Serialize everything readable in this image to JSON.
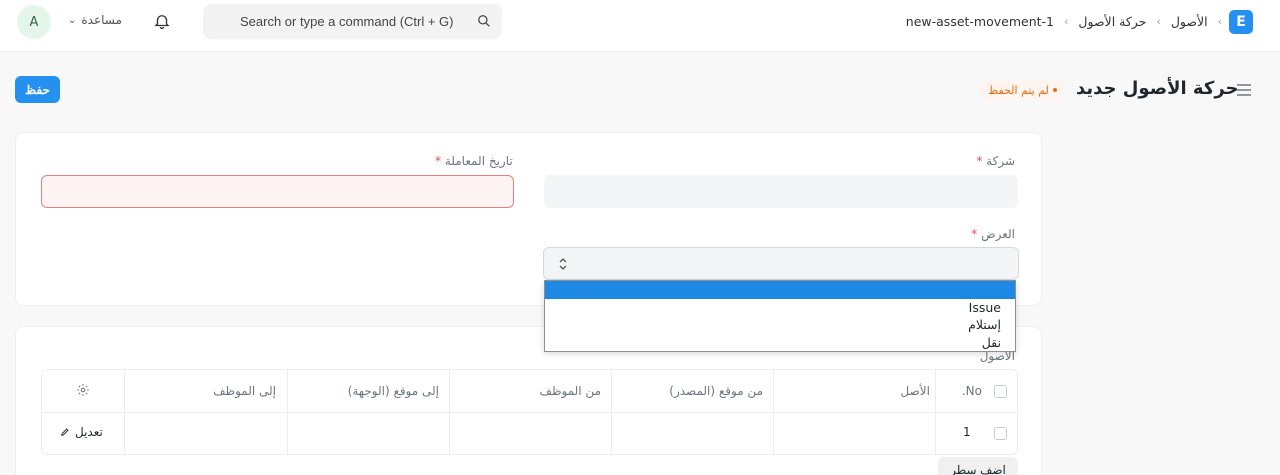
{
  "navbar": {
    "avatar_letter": "A",
    "help_label": "مساعدة",
    "search_placeholder": "Search or type a command (Ctrl + G)",
    "breadcrumbs": [
      "الأصول",
      "حركة الأصول",
      "new-asset-movement-1"
    ],
    "logo_letter": "E"
  },
  "page": {
    "title": "حركة الأصول جديد",
    "status": "لم يتم الحفظ",
    "save_label": "حفظ"
  },
  "form": {
    "company_label": "شركة",
    "date_label": "تاريخ المعاملة",
    "purpose_label": "العرض",
    "required_mark": "*",
    "purpose_options": [
      "",
      "Issue",
      "إستلام",
      "نقل"
    ]
  },
  "assets": {
    "section_label": "الأصول",
    "columns": [
      "No.",
      "الأصل",
      "من موقع (المصدر)",
      "من الموظف",
      "إلى موقع (الوجهة)",
      "إلى الموظف"
    ],
    "rows": [
      {
        "no": "1"
      }
    ],
    "edit_label": "تعديل",
    "add_row_label": "اضف سطر"
  },
  "colors": {
    "primary": "#2490ef",
    "warning": "#e86c13",
    "danger": "#e24c4c",
    "highlight": "#1e88e5"
  }
}
